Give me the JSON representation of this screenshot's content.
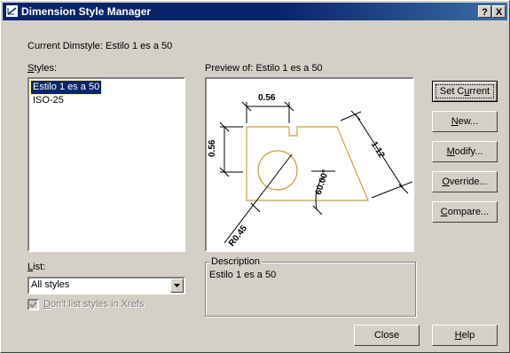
{
  "window": {
    "title": "Dimension Style Manager",
    "help_btn": "?",
    "close_btn": "X"
  },
  "current_dimstyle": "Current Dimstyle: Estilo 1 es a 50",
  "styles": {
    "label": "Styles:",
    "items": [
      "Estilo 1 es a 50",
      "ISO-25"
    ],
    "selected": "Estilo 1 es a 50"
  },
  "preview": {
    "label": "Preview of: Estilo 1 es a 50",
    "dims": {
      "top": "0.56",
      "left": "0.56",
      "diag": "1.12",
      "angle": "60.00°",
      "radius": "R0.45"
    }
  },
  "buttons": {
    "set_current": "Set Current",
    "new": "New...",
    "modify": "Modify...",
    "override": "Override...",
    "compare": "Compare...",
    "close": "Close",
    "help": "Help"
  },
  "list": {
    "label": "List:",
    "value": "All styles"
  },
  "dont_list_xrefs": {
    "label": "Don't list styles in Xrefs",
    "checked": true
  },
  "description": {
    "label": "Description",
    "text": "Estilo 1 es a 50"
  },
  "colors": {
    "title_bar": "#0a246a",
    "selection": "#0a246a",
    "face": "#d4d0c8",
    "drawing_outline": "#c8a040"
  }
}
